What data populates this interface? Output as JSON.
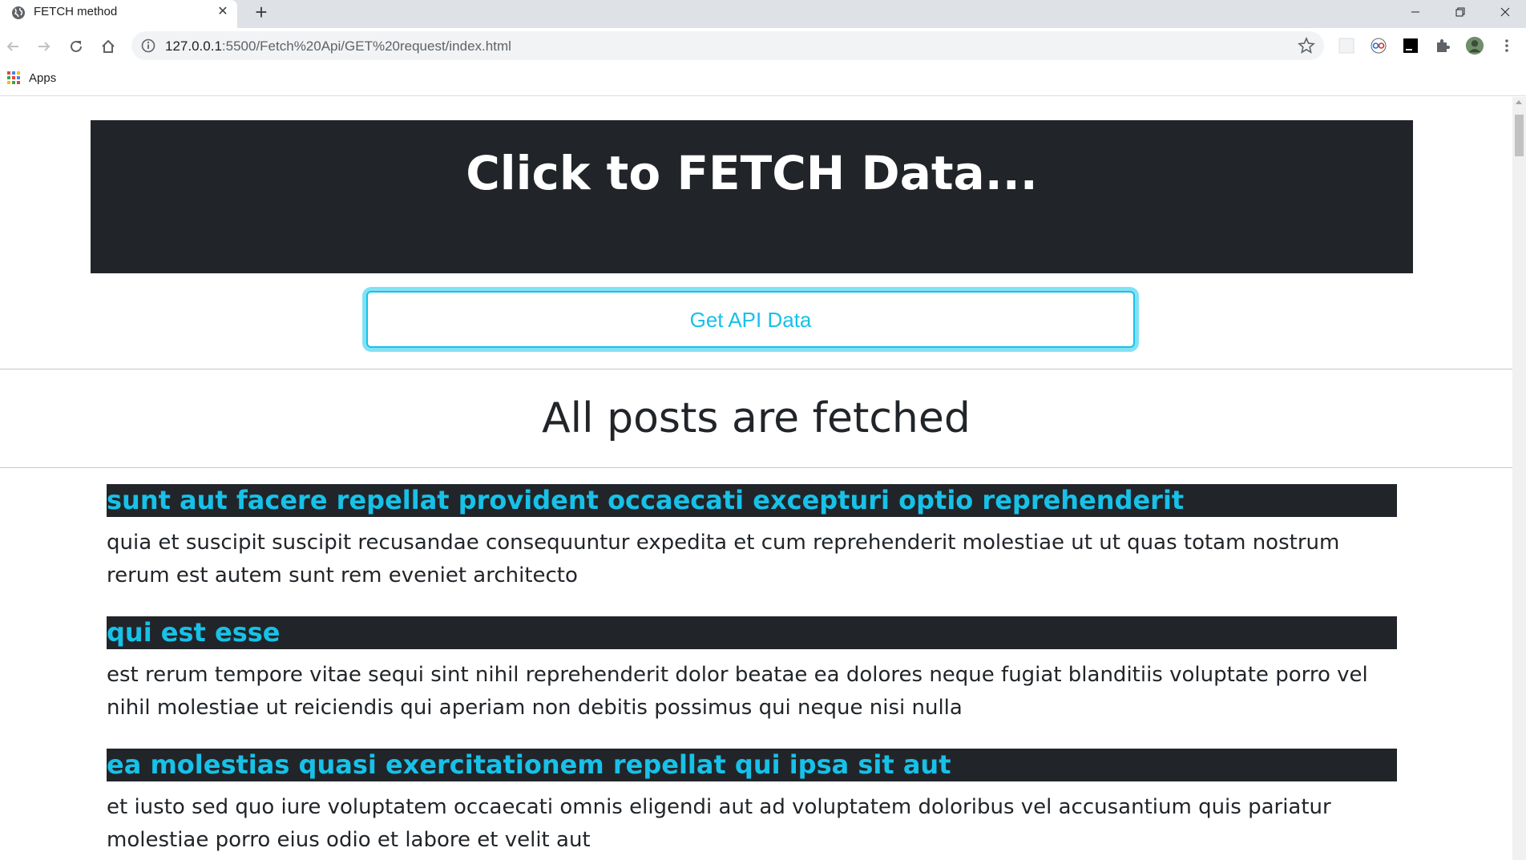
{
  "browser": {
    "tab_title": "FETCH method",
    "tab_close": "✕",
    "new_tab": "+",
    "url_host": "127.0.0.1",
    "url_path": ":5500/Fetch%20Api/GET%20request/index.html",
    "bookmarks": {
      "apps_label": "Apps"
    }
  },
  "page": {
    "jumbotron_title": "Click to FETCH Data...",
    "get_button_label": "Get API Data",
    "posts_heading": "All posts are fetched",
    "posts": [
      {
        "title": "sunt aut facere repellat provident occaecati excepturi optio reprehenderit",
        "body": "quia et suscipit suscipit recusandae consequuntur expedita et cum reprehenderit molestiae ut ut quas totam nostrum rerum est autem sunt rem eveniet architecto"
      },
      {
        "title": "qui est esse",
        "body": "est rerum tempore vitae sequi sint nihil reprehenderit dolor beatae ea dolores neque fugiat blanditiis voluptate porro vel nihil molestiae ut reiciendis qui aperiam non debitis possimus qui neque nisi nulla"
      },
      {
        "title": "ea molestias quasi exercitationem repellat qui ipsa sit aut",
        "body": "et iusto sed quo iure voluptatem occaecati omnis eligendi aut ad voluptatem doloribus vel accusantium quis pariatur molestiae porro eius odio et labore et velit aut"
      }
    ]
  },
  "colors": {
    "jumbotron_bg": "#212529",
    "accent_cyan": "#17c1e8",
    "text_dark": "#212529"
  }
}
